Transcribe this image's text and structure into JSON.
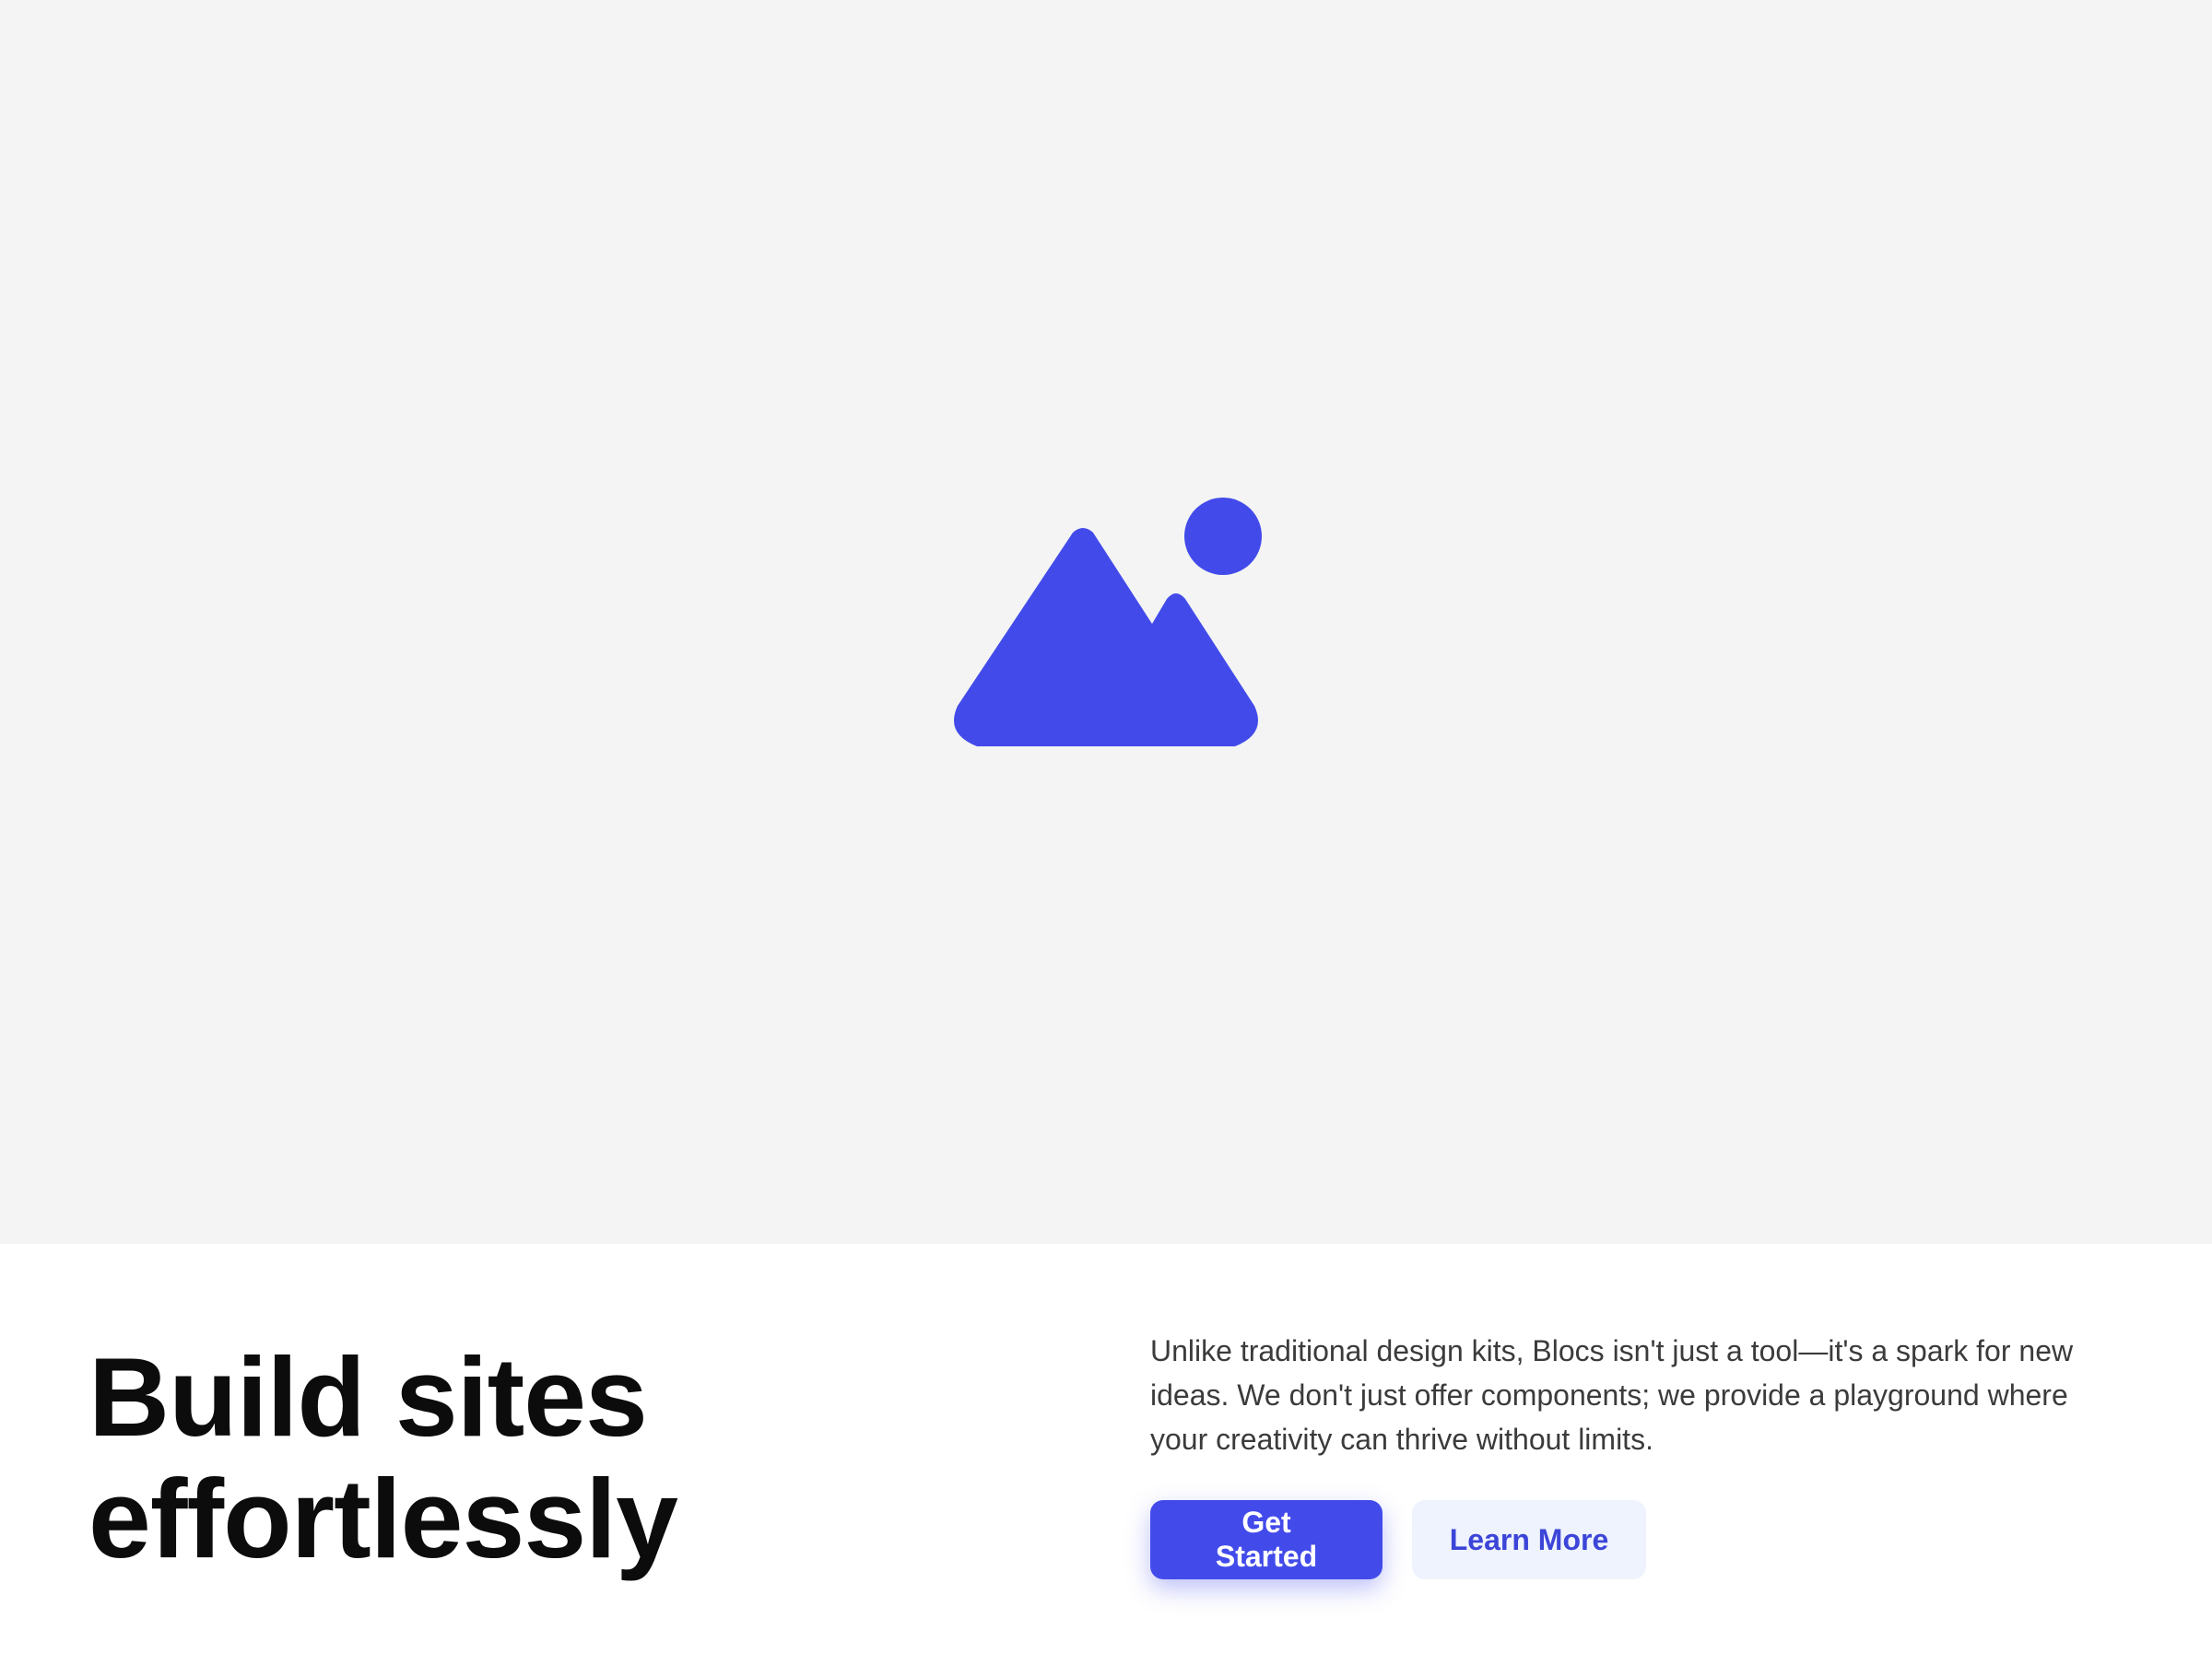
{
  "hero": {
    "image_icon": "image-placeholder-icon",
    "background_color": "#f4f4f4",
    "icon_color": "#424bea"
  },
  "content": {
    "headline_line1": "Build sites",
    "headline_line2": "effortlessly",
    "description": "Unlike traditional design kits, Blocs isn't just a tool—it's a spark for new ideas. We don't just offer components; we provide a playground where your creativity can thrive without limits."
  },
  "actions": {
    "primary_label": "Get Started",
    "secondary_label": "Learn More",
    "primary_color": "#424bea",
    "secondary_bg": "#eef3fd"
  }
}
